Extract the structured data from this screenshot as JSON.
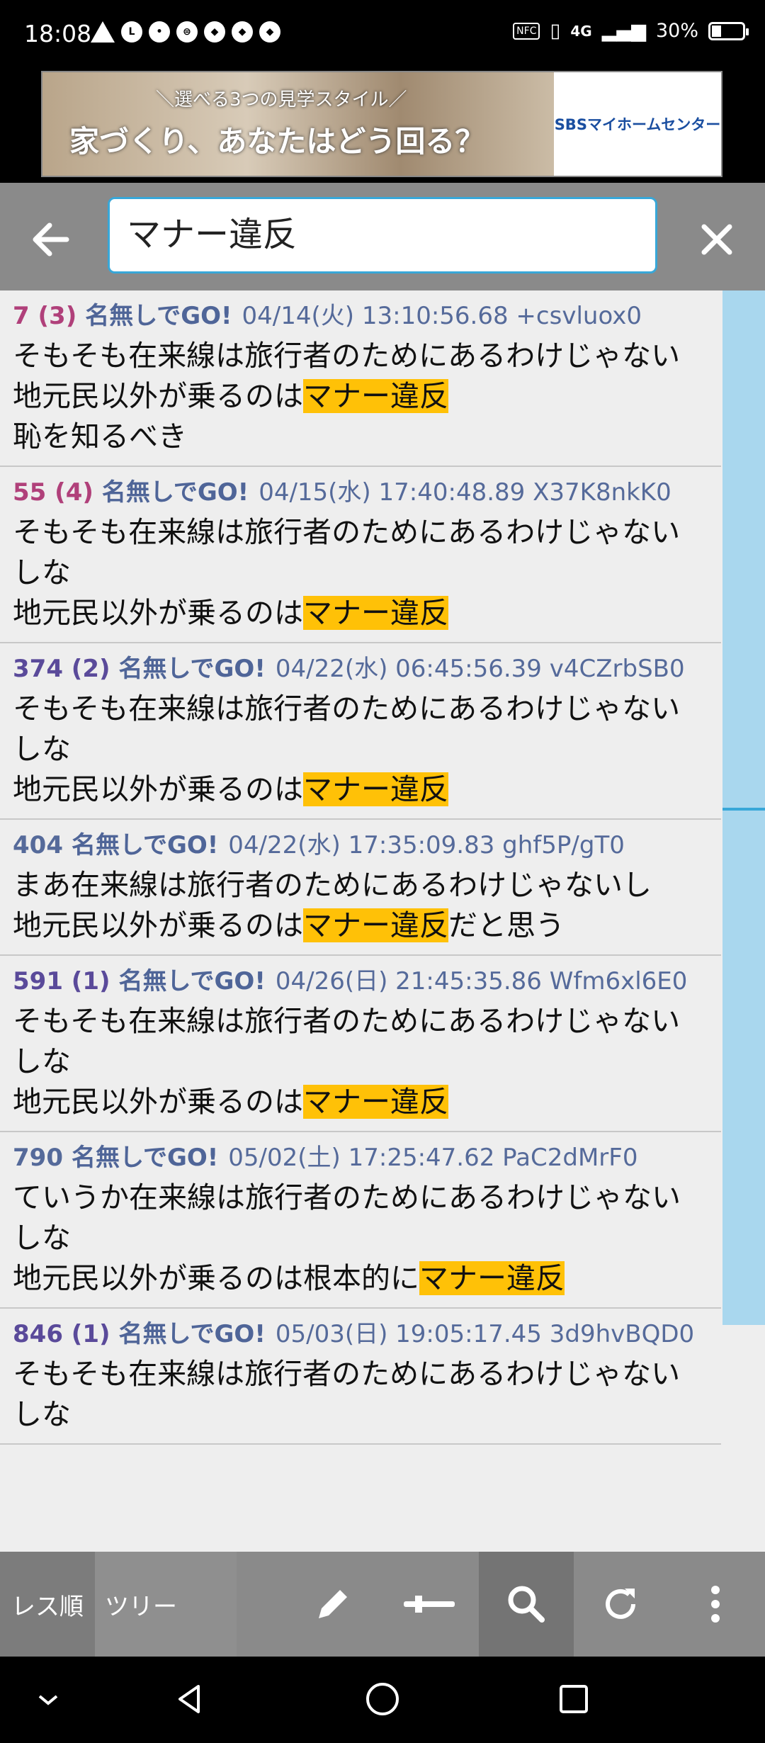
{
  "status_bar": {
    "time": "18:08",
    "network": "4G",
    "battery": "30%",
    "battery_level": 0.3,
    "nfc": "NFC"
  },
  "ad": {
    "line1": "＼選べる3つの見学スタイル／",
    "line2": "家づくり、あなたはどう回る？",
    "brand": "SBSマイホームセンター"
  },
  "search": {
    "query": "マナー違反"
  },
  "posts": [
    {
      "num": "7 (3)",
      "num_color": "#b0407a",
      "name": "名無しでGO!",
      "date": "04/14(火) 13:10:56.68 +csvluox0",
      "lines": [
        {
          "pre": "そもそも在来線は旅行者のためにあるわけじゃない"
        },
        {
          "pre": "地元民以外が乗るのは",
          "hl": "マナー違反",
          "post": ""
        },
        {
          "pre": "恥を知るべき"
        }
      ]
    },
    {
      "num": "55 (4)",
      "num_color": "#b0407a",
      "name": "名無しでGO!",
      "date": "04/15(水) 17:40:48.89 X37K8nkK0",
      "lines": [
        {
          "pre": "そもそも在来線は旅行者のためにあるわけじゃないしな"
        },
        {
          "pre": "地元民以外が乗るのは",
          "hl": "マナー違反",
          "post": ""
        }
      ]
    },
    {
      "num": "374 (2)",
      "num_color": "#5a4a9a",
      "name": "名無しでGO!",
      "date": "04/22(水) 06:45:56.39 v4CZrbSB0",
      "lines": [
        {
          "pre": "そもそも在来線は旅行者のためにあるわけじゃないしな"
        },
        {
          "pre": "地元民以外が乗るのは",
          "hl": "マナー違反",
          "post": ""
        }
      ]
    },
    {
      "num": "404",
      "num_color": "#556a9a",
      "name": "名無しでGO!",
      "date": "04/22(水) 17:35:09.83 ghf5P/gT0",
      "lines": [
        {
          "pre": "まあ在来線は旅行者のためにあるわけじゃないし"
        },
        {
          "pre": "地元民以外が乗るのは",
          "hl": "マナー違反",
          "post": "だと思う"
        }
      ]
    },
    {
      "num": "591 (1)",
      "num_color": "#5a4a9a",
      "name": "名無しでGO!",
      "date": "04/26(日) 21:45:35.86 Wfm6xl6E0",
      "lines": [
        {
          "pre": "そもそも在来線は旅行者のためにあるわけじゃないしな"
        },
        {
          "pre": "地元民以外が乗るのは",
          "hl": "マナー違反",
          "post": ""
        }
      ]
    },
    {
      "num": "790",
      "num_color": "#556a9a",
      "name": "名無しでGO!",
      "date": "05/02(土) 17:25:47.62 PaC2dMrF0",
      "lines": [
        {
          "pre": "ていうか在来線は旅行者のためにあるわけじゃないしな"
        },
        {
          "pre": "地元民以外が乗るのは根本的に",
          "hl": "マナー違反",
          "post": ""
        }
      ]
    },
    {
      "num": "846 (1)",
      "num_color": "#5a4a9a",
      "name": "名無しでGO!",
      "date": "05/03(日) 19:05:17.45 3d9hvBQD0",
      "lines": [
        {
          "pre": "そもそも在来線は旅行者のためにあるわけじゃないしな"
        }
      ]
    }
  ],
  "toolbar": {
    "tab_res": "レス順",
    "tab_tree": "ツリー",
    "icons": [
      "pencil-icon",
      "slider-icon",
      "search-icon",
      "refresh-icon",
      "more-vert-icon"
    ]
  }
}
